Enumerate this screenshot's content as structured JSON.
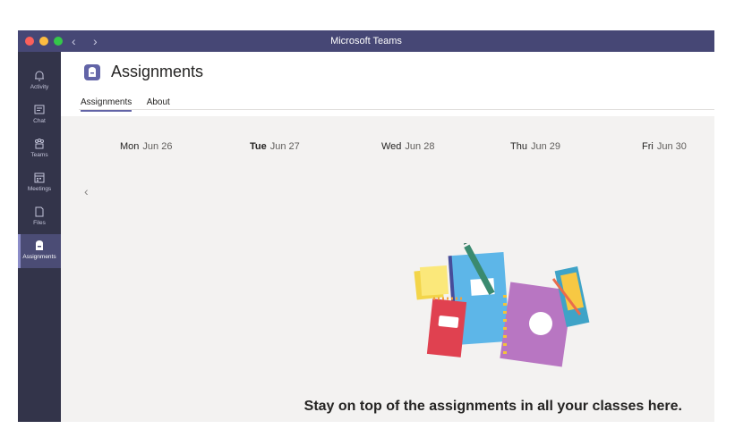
{
  "window": {
    "title": "Microsoft Teams"
  },
  "rail": {
    "items": [
      {
        "label": "Activity",
        "icon": "bell-icon"
      },
      {
        "label": "Chat",
        "icon": "chat-icon"
      },
      {
        "label": "Teams",
        "icon": "teams-icon"
      },
      {
        "label": "Meetings",
        "icon": "calendar-icon"
      },
      {
        "label": "Files",
        "icon": "file-icon"
      },
      {
        "label": "Assignments",
        "icon": "assignments-icon",
        "active": true
      }
    ]
  },
  "header": {
    "title": "Assignments",
    "tabs": [
      {
        "label": "Assignments",
        "active": true
      },
      {
        "label": "About"
      }
    ]
  },
  "calendar": {
    "days": [
      {
        "weekday": "Mon",
        "date": "Jun 26"
      },
      {
        "weekday": "Tue",
        "date": "Jun 27",
        "today": true
      },
      {
        "weekday": "Wed",
        "date": "Jun 28"
      },
      {
        "weekday": "Thu",
        "date": "Jun 29"
      },
      {
        "weekday": "Fri",
        "date": "Jun 30"
      }
    ]
  },
  "empty_state": {
    "message": "Stay on top of the assignments in all your classes here."
  },
  "colors": {
    "accent": "#6264a7",
    "titlebar": "#464775",
    "rail": "#33344a"
  }
}
